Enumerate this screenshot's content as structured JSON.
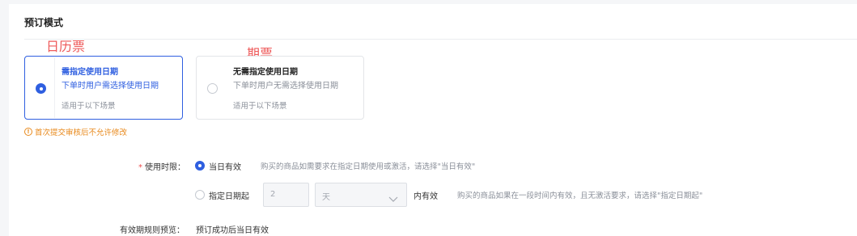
{
  "section": {
    "title": "预订模式"
  },
  "annotations": {
    "calendar_ticket": "日历票",
    "period_ticket": "期票"
  },
  "booking_cards": [
    {
      "title": "需指定使用日期",
      "desc": "下单时用户需选择使用日期",
      "scene": "适用于以下场景",
      "selected": true
    },
    {
      "title": "无需指定使用日期",
      "desc": "下单时用户无需选择使用日期",
      "scene": "适用于以下场景",
      "selected": false
    }
  ],
  "warning": {
    "icon": "info-circle-icon",
    "text": "首次提交审核后不允许修改"
  },
  "usage": {
    "required_mark": "*",
    "label": "使用时限：",
    "options": [
      {
        "label": "当日有效",
        "checked": true,
        "hint": "购买的商品如需要求在指定日期使用或激活，请选择\"当日有效\""
      },
      {
        "label": "指定日期起",
        "checked": false,
        "hint": "购买的商品如果在一段时间内有效，且无激活要求，请选择\"指定日期起\""
      }
    ],
    "days_value": "2",
    "unit_value": "天",
    "unit_suffix": "内有效"
  },
  "preview": {
    "label": "有效期规则预览：",
    "value": "预订成功后当日有效"
  },
  "colors": {
    "accent": "#2f5fe0",
    "warning": "#e8891c",
    "annotation": "#ee5a5a"
  }
}
